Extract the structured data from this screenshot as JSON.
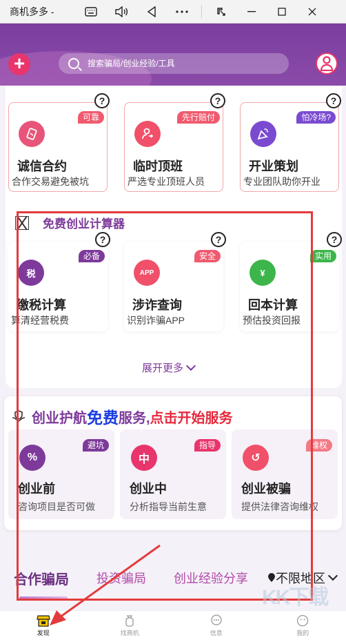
{
  "window": {
    "title": "商机多多 -",
    "controls": [
      "keyboard-icon",
      "volume-icon",
      "back-triangle-icon",
      "more-dots-icon",
      "pin-icon",
      "minimize-icon",
      "maximize-icon",
      "close-icon"
    ]
  },
  "header": {
    "search_placeholder": "搜索骗局/创业经验/工具"
  },
  "top_cards": [
    {
      "name": "诚信合约",
      "desc": "合作交易避免被坑",
      "tag": "可靠",
      "icon": "contract-icon",
      "color": "#e8557a",
      "tag_color": "#f05a6e"
    },
    {
      "name": "临时顶班",
      "desc": "严选专业顶班人员",
      "tag": "先行赔付",
      "icon": "person-swap-icon",
      "color": "#f0506a",
      "tag_color": "#f05a6e"
    },
    {
      "name": "开业策划",
      "desc": "专业团队助你开业",
      "tag": "怕冷场?",
      "icon": "party-icon",
      "color": "#7a4bd0",
      "tag_color": "#7a4bd0"
    }
  ],
  "calculator": {
    "title": "免费创业计算器",
    "cards": [
      {
        "name": "缴税计算",
        "desc": "算清经营税费",
        "tag": "必备",
        "icon_text": "税",
        "color": "#7d3a9a",
        "tag_color": "#7d3a9a"
      },
      {
        "name": "涉诈查询",
        "desc": "识别诈骗APP",
        "tag": "安全",
        "icon_text": "APP",
        "color": "#f0506a",
        "tag_color": "#f05a6e"
      },
      {
        "name": "回本计算",
        "desc": "预估投资回报",
        "tag": "实用",
        "icon_text": "¥",
        "color": "#3cb54a",
        "tag_color": "#3cb54a"
      }
    ],
    "expand_label": "展开更多"
  },
  "service": {
    "title_parts": [
      "创业护航",
      "免费",
      "服务,",
      "点击开始服务"
    ],
    "cards": [
      {
        "name": "创业前",
        "desc": "咨询项目是否可做",
        "tag": "避坑",
        "icon_text": "%",
        "color": "#7d3a9a",
        "tag_color": "#7d3a9a"
      },
      {
        "name": "创业中",
        "desc": "分析指导当前生意",
        "tag": "指导",
        "icon_text": "中",
        "color": "#e8356b",
        "tag_color": "#e8356b"
      },
      {
        "name": "创业被骗",
        "desc": "提供法律咨询维权",
        "tag": "维权",
        "icon_text": "↺",
        "color": "#f0506a",
        "tag_color": "#f27a86"
      }
    ]
  },
  "tabs": [
    {
      "label": "合作骗局",
      "active": true
    },
    {
      "label": "投资骗局",
      "active": false
    },
    {
      "label": "创业经验分享",
      "active": false
    }
  ],
  "region": "不限地区",
  "bottom_nav": [
    {
      "label": "发现",
      "icon": "shop-icon",
      "active": true
    },
    {
      "label": "找商机",
      "icon": "money-bag-icon",
      "active": false
    },
    {
      "label": "信息",
      "icon": "chat-icon",
      "active": false
    },
    {
      "label": "我的",
      "icon": "face-icon",
      "active": false
    }
  ],
  "watermark": "KK下载"
}
